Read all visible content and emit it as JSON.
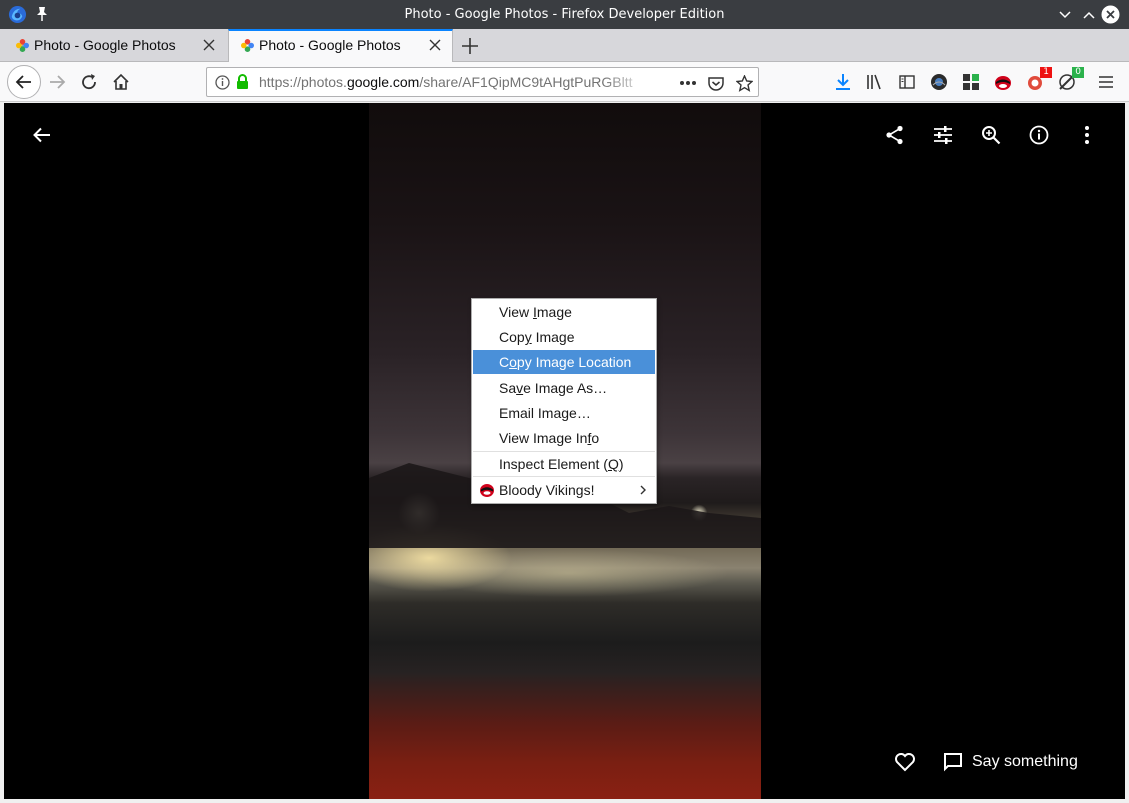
{
  "window": {
    "title": "Photo - Google Photos - Firefox Developer Edition"
  },
  "tabs": [
    {
      "label": "Photo - Google Photos",
      "active": false
    },
    {
      "label": "Photo - Google Photos",
      "active": true
    }
  ],
  "navbar": {
    "url_prefix": "https://photos.",
    "url_domain": "google.com",
    "url_path": "/share/AF1QipMC9tAHgtPuRGBltt",
    "addon_badges": {
      "first": "1",
      "second": "0"
    }
  },
  "viewer": {
    "comment_label": "Say something"
  },
  "context_menu": {
    "items": [
      {
        "pre": "View ",
        "acc": "I",
        "post": "mage"
      },
      {
        "pre": "Cop",
        "acc": "y",
        "post": " Image"
      },
      {
        "pre": "C",
        "acc": "o",
        "post": "py Image Location"
      },
      {
        "pre": "Sa",
        "acc": "v",
        "post": "e Image As…"
      },
      {
        "pre": "Email Ima",
        "acc": "g",
        "post": "e…"
      },
      {
        "pre": "View Image In",
        "acc": "f",
        "post": "o"
      },
      {
        "pre": "Inspect Element (",
        "acc": "Q",
        "post": ")"
      },
      {
        "pre": "Bloody Vikings!",
        "acc": "",
        "post": ""
      }
    ]
  },
  "colors": {
    "accent": "#0a84ff",
    "menu_highlight": "#4a90d9"
  }
}
